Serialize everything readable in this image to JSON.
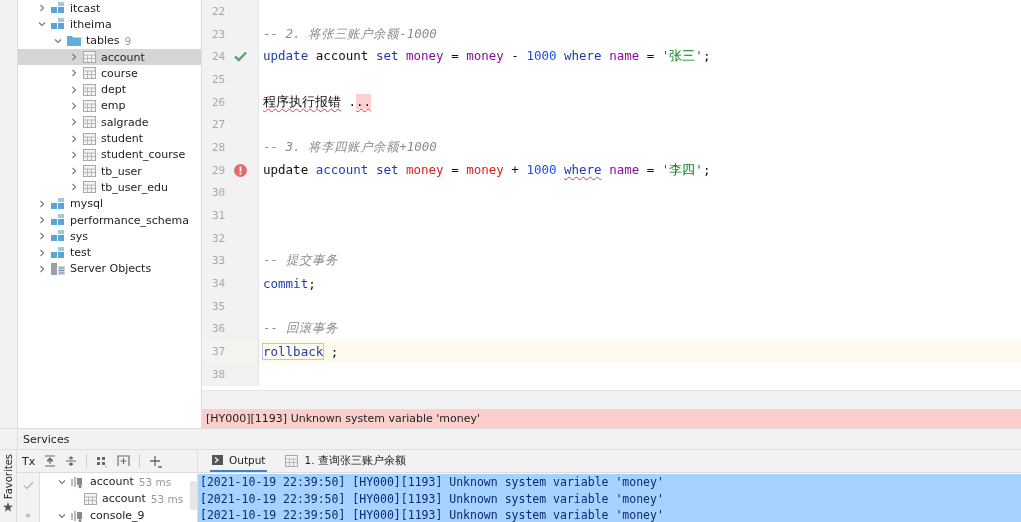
{
  "tree": [
    {
      "label": "itcast",
      "kind": "schema",
      "expanded": false,
      "selected": false
    },
    {
      "label": "itheima",
      "kind": "schema",
      "expanded": true,
      "selected": false,
      "children": [
        {
          "label": "tables",
          "kind": "folder",
          "count": "9",
          "expanded": true,
          "selected": false,
          "children": [
            {
              "label": "account",
              "kind": "table",
              "expanded": false,
              "selected": true
            },
            {
              "label": "course",
              "kind": "table",
              "expanded": false,
              "selected": false
            },
            {
              "label": "dept",
              "kind": "table",
              "expanded": false,
              "selected": false
            },
            {
              "label": "emp",
              "kind": "table",
              "expanded": false,
              "selected": false
            },
            {
              "label": "salgrade",
              "kind": "table",
              "expanded": false,
              "selected": false
            },
            {
              "label": "student",
              "kind": "table",
              "expanded": false,
              "selected": false
            },
            {
              "label": "student_course",
              "kind": "table",
              "expanded": false,
              "selected": false
            },
            {
              "label": "tb_user",
              "kind": "table",
              "expanded": false,
              "selected": false
            },
            {
              "label": "tb_user_edu",
              "kind": "table",
              "expanded": false,
              "selected": false
            }
          ]
        }
      ]
    },
    {
      "label": "mysql",
      "kind": "schema",
      "expanded": false,
      "selected": false
    },
    {
      "label": "performance_schema",
      "kind": "schema",
      "expanded": false,
      "selected": false
    },
    {
      "label": "sys",
      "kind": "schema",
      "expanded": false,
      "selected": false
    },
    {
      "label": "test",
      "kind": "schema",
      "expanded": false,
      "selected": false
    },
    {
      "label": "Server Objects",
      "kind": "server",
      "expanded": false,
      "selected": false
    }
  ],
  "editor": {
    "lines": [
      {
        "num": "22"
      },
      {
        "num": "23",
        "tokens": [
          {
            "t": "-- 2. 将张三账户余额-1000",
            "kind": "comment"
          }
        ]
      },
      {
        "num": "24",
        "kind": "success",
        "tokens": [
          {
            "t": "update",
            "kind": "keyword"
          },
          {
            "t": "account",
            "kind": "identifier"
          },
          {
            "t": "set",
            "kind": "keyword"
          },
          {
            "t": "money",
            "kind": "column"
          },
          {
            "t": "=",
            "kind": "operator"
          },
          {
            "t": "money",
            "kind": "column"
          },
          {
            "t": "-",
            "kind": "operator"
          },
          {
            "t": "1000",
            "kind": "number"
          },
          {
            "t": "where",
            "kind": "keyword"
          },
          {
            "t": "name",
            "kind": "column"
          },
          {
            "t": "=",
            "kind": "operator"
          },
          {
            "t": "'张三'",
            "kind": "string"
          },
          {
            "t": ";",
            "kind": "punct"
          }
        ]
      },
      {
        "num": "25"
      },
      {
        "num": "26",
        "tokens": [
          {
            "t": "程序执行报错",
            "kind": "operator",
            "squiggle": true
          },
          {
            "t": ".",
            "kind": "operator"
          },
          {
            "t": "..",
            "kind": "punct",
            "highlight": true,
            "squiggle": true
          }
        ]
      },
      {
        "num": "27"
      },
      {
        "num": "28",
        "tokens": [
          {
            "t": "-- 3. 将李四账户余额+1000",
            "kind": "comment"
          }
        ]
      },
      {
        "num": "29",
        "kind": "error",
        "tokens": [
          {
            "t": "update",
            "kind": "identifier"
          },
          {
            "t": "account",
            "kind": "keyword"
          },
          {
            "t": "set",
            "kind": "keyword"
          },
          {
            "t": "money",
            "kind": "error"
          },
          {
            "t": "=",
            "kind": "operator"
          },
          {
            "t": "money",
            "kind": "error"
          },
          {
            "t": "+",
            "kind": "operator"
          },
          {
            "t": "1000",
            "kind": "number"
          },
          {
            "t": "where",
            "kind": "keyword",
            "squiggle": true
          },
          {
            "t": "name",
            "kind": "column"
          },
          {
            "t": "=",
            "kind": "operator"
          },
          {
            "t": "'李四'",
            "kind": "string"
          },
          {
            "t": ";",
            "kind": "punct"
          }
        ]
      },
      {
        "num": "30"
      },
      {
        "num": "31"
      },
      {
        "num": "32"
      },
      {
        "num": "33",
        "tokens": [
          {
            "t": "-- 提交事务",
            "kind": "comment"
          }
        ]
      },
      {
        "num": "34",
        "tokens": [
          {
            "t": "commit",
            "kind": "keyword"
          },
          {
            "t": ";",
            "kind": "punct"
          }
        ]
      },
      {
        "num": "35"
      },
      {
        "num": "36",
        "tokens": [
          {
            "t": "-- 回滚事务",
            "kind": "comment"
          }
        ]
      },
      {
        "num": "37",
        "current": true,
        "tokens": [
          {
            "t": "rollback",
            "kind": "keyword",
            "boxed": true
          },
          {
            "t": ";",
            "kind": "operator"
          }
        ]
      },
      {
        "num": "38"
      }
    ],
    "error_message": "[HY000][1193] Unknown system variable 'money'"
  },
  "services": {
    "title": "Services",
    "toolbar": [
      {
        "kind": "tx",
        "label": "Tx"
      },
      {
        "kind": "expand"
      },
      {
        "kind": "collapse"
      },
      {
        "kind": "sep"
      },
      {
        "kind": "group"
      },
      {
        "kind": "add-frame"
      },
      {
        "kind": "sep"
      },
      {
        "kind": "plus"
      }
    ],
    "more_label": "»",
    "tree": [
      {
        "label": "account",
        "time": "53 ms",
        "kind": "session",
        "expanded": true,
        "children": [
          {
            "label": "account",
            "time": "53 ms",
            "kind": "table"
          }
        ]
      },
      {
        "label": "console_9",
        "kind": "session",
        "expanded": true
      }
    ],
    "tabs": [
      {
        "label": "Output",
        "kind": "output",
        "selected": true
      },
      {
        "label": "1. 查询张三账户余额",
        "kind": "table",
        "selected": false
      }
    ],
    "log": [
      {
        "text": "[2021-10-19 22:39:50] [HY000][1193] Unknown system variable 'money'",
        "selected": true
      },
      {
        "text": "[2021-10-19 22:39:50] [HY000][1193] Unknown system variable 'money'",
        "selected": true
      },
      {
        "text": "[2021-10-19 22:39:50] [HY000][1193] Unknown system variable 'money'",
        "selected": true
      }
    ]
  },
  "favorites": {
    "label": "Favorites"
  }
}
